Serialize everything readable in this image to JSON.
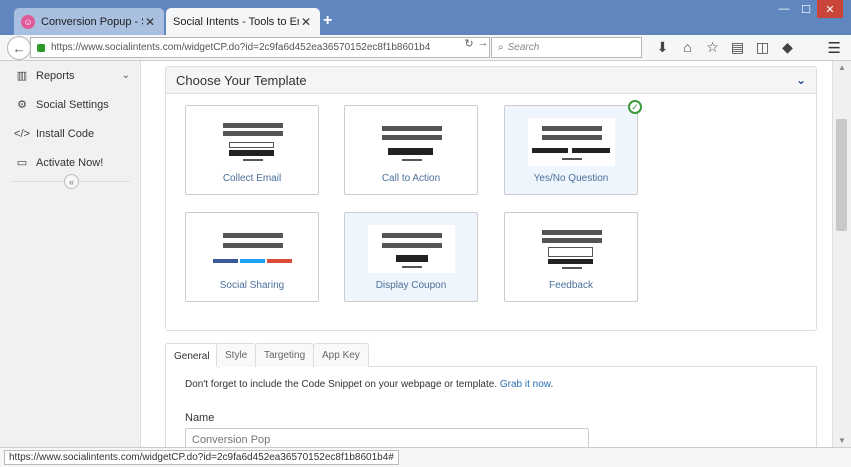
{
  "browser": {
    "tabs": [
      {
        "label": "Conversion Popup - Social ..."
      },
      {
        "label": "Social Intents - Tools to Engag..."
      }
    ],
    "url": "https://www.socialintents.com/widgetCP.do?id=2c9fa6d452ea36570152ec8f1b8601b4",
    "search_placeholder": "Search",
    "status_url": "https://www.socialintents.com/widgetCP.do?id=2c9fa6d452ea36570152ec8f1b8601b4#"
  },
  "sidebar": {
    "items": [
      {
        "label": "Reports",
        "icon": "bar-chart-icon"
      },
      {
        "label": "Social Settings",
        "icon": "gears-icon"
      },
      {
        "label": "Install Code",
        "icon": "code-icon"
      },
      {
        "label": "Activate Now!",
        "icon": "credit-card-icon"
      }
    ]
  },
  "template_panel": {
    "title": "Choose Your Template",
    "templates": [
      {
        "label": "Collect Email",
        "selected": false
      },
      {
        "label": "Call to Action",
        "selected": false
      },
      {
        "label": "Yes/No Question",
        "selected": true
      },
      {
        "label": "Social Sharing",
        "selected": false
      },
      {
        "label": "Display Coupon",
        "selected": false
      },
      {
        "label": "Feedback",
        "selected": false
      }
    ]
  },
  "settings": {
    "tabs": [
      "General",
      "Style",
      "Targeting",
      "App Key"
    ],
    "active_tab": "General",
    "notice": "Don't forget to include the Code Snippet on your webpage or template.",
    "notice_link": "Grab it now",
    "name_label": "Name",
    "name_placeholder": "Conversion Pop"
  },
  "colors": {
    "titlebar": "#5f86bf",
    "link": "#2a6fb0",
    "check": "#3a9a3a"
  }
}
